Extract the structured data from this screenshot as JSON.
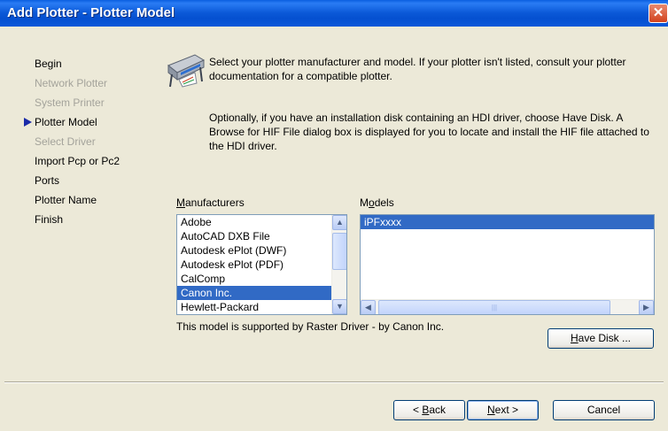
{
  "window": {
    "title": "Add Plotter - Plotter Model",
    "close_glyph": "✕"
  },
  "steps": [
    {
      "label": "Begin",
      "enabled": true
    },
    {
      "label": "Network Plotter",
      "enabled": false
    },
    {
      "label": "System Printer",
      "enabled": false
    },
    {
      "label": "Plotter Model",
      "enabled": true,
      "current": true
    },
    {
      "label": "Select Driver",
      "enabled": false
    },
    {
      "label": "Import Pcp or Pc2",
      "enabled": true
    },
    {
      "label": "Ports",
      "enabled": true
    },
    {
      "label": "Plotter Name",
      "enabled": true
    },
    {
      "label": "Finish",
      "enabled": true
    }
  ],
  "intro_text": "Select your plotter manufacturer and model. If your plotter isn't listed, consult your plotter documentation for a compatible plotter.",
  "hdi_text": "Optionally, if you have an installation disk containing an HDI driver, choose Have Disk. A Browse for HIF File dialog box is displayed for you to locate and install the HIF file attached to the HDI driver.",
  "manufacturers": {
    "label_prefix": "",
    "label_key": "M",
    "label_rest": "anufacturers",
    "items": [
      "Adobe",
      "AutoCAD DXB File",
      "Autodesk ePlot (DWF)",
      "Autodesk ePlot (PDF)",
      "CalComp",
      "Canon Inc.",
      "Hewlett-Packard"
    ],
    "selected": "Canon Inc."
  },
  "models": {
    "label_prefix": "M",
    "label_key": "o",
    "label_rest": "dels",
    "items": [
      "iPFxxxx"
    ],
    "selected": "iPFxxxx"
  },
  "driver_note": "This model is supported by Raster Driver - by Canon Inc.",
  "buttons": {
    "have_disk": {
      "key": "H",
      "rest": "ave Disk ..."
    },
    "back": {
      "prefix": "< ",
      "key": "B",
      "rest": "ack"
    },
    "next": {
      "key": "N",
      "rest": "ext >"
    },
    "cancel": "Cancel"
  },
  "colors": {
    "selection": "#316ac5",
    "title_bar": "#0b59d8",
    "dialog_bg": "#ece9d8"
  }
}
